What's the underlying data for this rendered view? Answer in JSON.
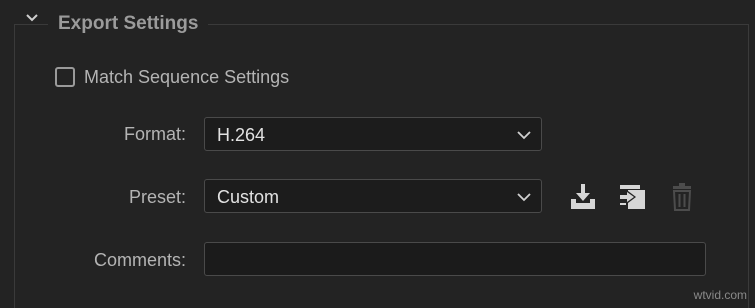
{
  "section": {
    "title": "Export Settings",
    "expanded": true
  },
  "match_sequence": {
    "label": "Match Sequence Settings",
    "checked": false
  },
  "format": {
    "label": "Format:",
    "value": "H.264"
  },
  "preset": {
    "label": "Preset:",
    "value": "Custom",
    "icons": [
      "save-preset-icon",
      "import-preset-icon",
      "delete-preset-icon"
    ]
  },
  "comments": {
    "label": "Comments:",
    "value": "",
    "placeholder": ""
  },
  "watermark": "wtvid.com",
  "colors": {
    "background": "#232323",
    "field_background": "#1c1c1c",
    "label_text": "#b4b4b4",
    "value_text": "#e2e2e2",
    "disabled_icon": "#4c4c4c"
  }
}
